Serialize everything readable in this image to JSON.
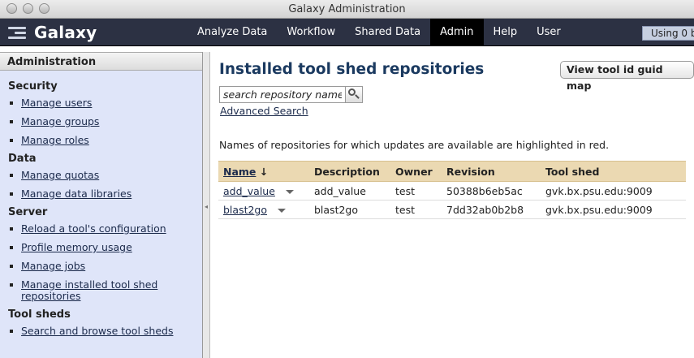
{
  "window": {
    "title": "Galaxy Administration"
  },
  "masthead": {
    "brand": "Galaxy",
    "nav": [
      "Analyze Data",
      "Workflow",
      "Shared Data",
      "Admin",
      "Help",
      "User"
    ],
    "active_tab": "Admin",
    "usage_text": "Using 0 b"
  },
  "sidebar": {
    "header": "Administration",
    "sections": [
      {
        "title": "Security",
        "items": [
          "Manage users",
          "Manage groups",
          "Manage roles"
        ]
      },
      {
        "title": "Data",
        "items": [
          "Manage quotas",
          "Manage data libraries"
        ]
      },
      {
        "title": "Server",
        "items": [
          "Reload a tool's configuration",
          "Profile memory usage",
          "Manage jobs",
          "Manage installed tool shed repositories"
        ]
      },
      {
        "title": "Tool sheds",
        "items": [
          "Search and browse tool sheds"
        ]
      }
    ]
  },
  "main": {
    "title": "Installed tool shed repositories",
    "guid_button": "View tool id guid map",
    "search_placeholder": "search repository name",
    "advanced_search": "Advanced Search",
    "notice": "Names of repositories for which updates are available are highlighted in red.",
    "table": {
      "columns": [
        "Name",
        "Description",
        "Owner",
        "Revision",
        "Tool shed"
      ],
      "sort_indicator": "↓",
      "rows": [
        {
          "name": "add_value",
          "description": "add_value",
          "owner": "test",
          "revision": "50388b6eb5ac",
          "tool_shed": "gvk.bx.psu.edu:9009"
        },
        {
          "name": "blast2go",
          "description": "blast2go",
          "owner": "test",
          "revision": "7dd32ab0b2b8",
          "tool_shed": "gvk.bx.psu.edu:9009"
        }
      ]
    }
  },
  "colors": {
    "masthead": "#2c3143",
    "sidebar": "#dfe5f9",
    "table_header": "#ebd9b2",
    "title": "#1b3a60"
  }
}
